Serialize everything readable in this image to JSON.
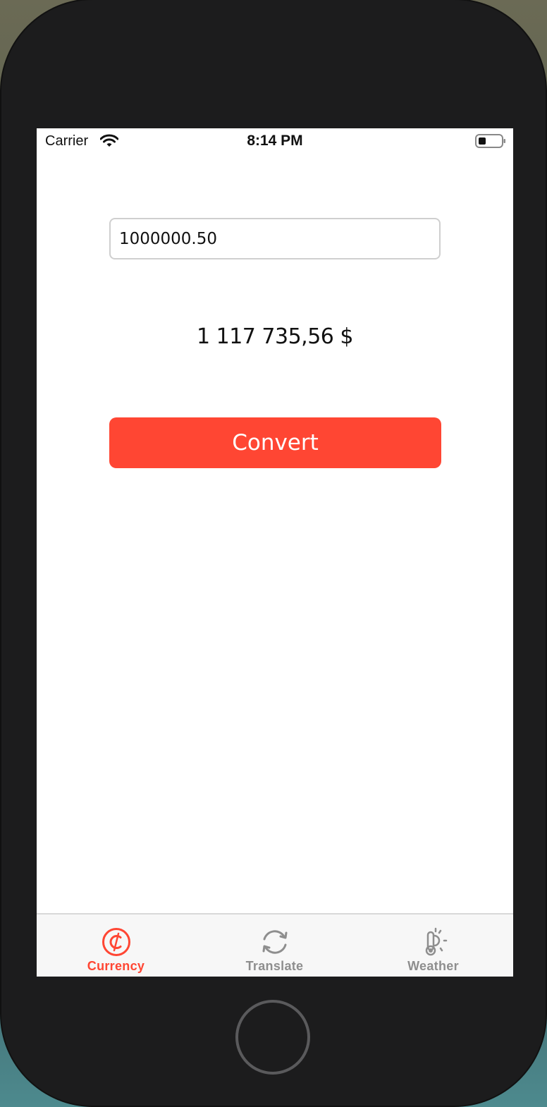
{
  "status_bar": {
    "carrier": "Carrier",
    "time": "8:14 PM"
  },
  "currency": {
    "amount_value": "1000000.50",
    "result": "1 117 735,56 $",
    "convert_label": "Convert"
  },
  "tab_bar": {
    "tabs": [
      {
        "label": "Currency",
        "icon": "currency-icon",
        "selected": true
      },
      {
        "label": "Translate",
        "icon": "translate-icon",
        "selected": false
      },
      {
        "label": "Weather",
        "icon": "weather-icon",
        "selected": false
      }
    ]
  },
  "colors": {
    "accent": "#ff4633",
    "tab_inactive": "#8e8e8e"
  }
}
